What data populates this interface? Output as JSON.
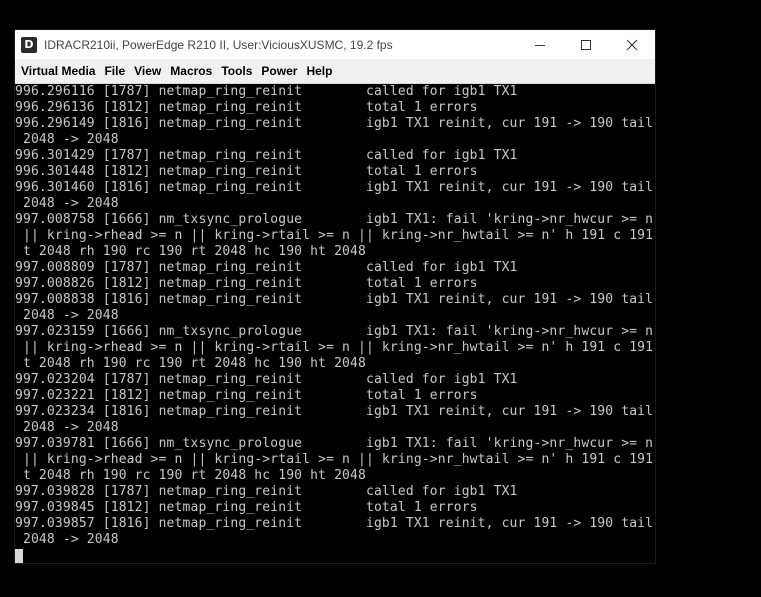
{
  "window": {
    "title": "IDRACR210ii, PowerEdge R210 II, User:ViciousXUSMC, 19.2 fps",
    "icon_glyph": "D"
  },
  "menu": [
    "Virtual Media",
    "File",
    "View",
    "Macros",
    "Tools",
    "Power",
    "Help"
  ],
  "console": {
    "lines": [
      "996.296116 [1787] netmap_ring_reinit        called for igb1 TX1",
      "996.296136 [1812] netmap_ring_reinit        total 1 errors",
      "996.296149 [1816] netmap_ring_reinit        igb1 TX1 reinit, cur 191 -> 190 tail",
      " 2048 -> 2048",
      "996.301429 [1787] netmap_ring_reinit        called for igb1 TX1",
      "996.301448 [1812] netmap_ring_reinit        total 1 errors",
      "996.301460 [1816] netmap_ring_reinit        igb1 TX1 reinit, cur 191 -> 190 tail",
      " 2048 -> 2048",
      "997.008758 [1666] nm_txsync_prologue        igb1 TX1: fail 'kring->nr_hwcur >= n",
      " || kring->rhead >= n || kring->rtail >= n || kring->nr_hwtail >= n' h 191 c 191",
      " t 2048 rh 190 rc 190 rt 2048 hc 190 ht 2048",
      "997.008809 [1787] netmap_ring_reinit        called for igb1 TX1",
      "997.008826 [1812] netmap_ring_reinit        total 1 errors",
      "997.008838 [1816] netmap_ring_reinit        igb1 TX1 reinit, cur 191 -> 190 tail",
      " 2048 -> 2048",
      "997.023159 [1666] nm_txsync_prologue        igb1 TX1: fail 'kring->nr_hwcur >= n",
      " || kring->rhead >= n || kring->rtail >= n || kring->nr_hwtail >= n' h 191 c 191",
      " t 2048 rh 190 rc 190 rt 2048 hc 190 ht 2048",
      "997.023204 [1787] netmap_ring_reinit        called for igb1 TX1",
      "997.023221 [1812] netmap_ring_reinit        total 1 errors",
      "997.023234 [1816] netmap_ring_reinit        igb1 TX1 reinit, cur 191 -> 190 tail",
      " 2048 -> 2048",
      "997.039781 [1666] nm_txsync_prologue        igb1 TX1: fail 'kring->nr_hwcur >= n",
      " || kring->rhead >= n || kring->rtail >= n || kring->nr_hwtail >= n' h 191 c 191",
      " t 2048 rh 190 rc 190 rt 2048 hc 190 ht 2048",
      "997.039828 [1787] netmap_ring_reinit        called for igb1 TX1",
      "997.039845 [1812] netmap_ring_reinit        total 1 errors",
      "997.039857 [1816] netmap_ring_reinit        igb1 TX1 reinit, cur 191 -> 190 tail",
      " 2048 -> 2048"
    ]
  },
  "colors": {
    "console_bg": "#000000",
    "console_fg": "#c8c8c8",
    "titlebar_bg": "#ffffff",
    "menubar_bg": "#f0f0f0"
  },
  "icons": {
    "app": "idrac-app-icon",
    "minimize": "minimize-icon",
    "maximize": "maximize-icon",
    "close": "close-icon"
  }
}
